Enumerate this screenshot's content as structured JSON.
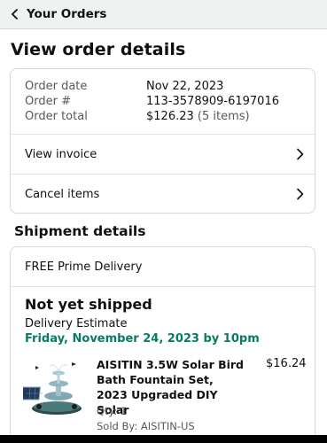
{
  "nav": {
    "back_label": "Your Orders"
  },
  "page": {
    "title": "View order details"
  },
  "order_summary": {
    "rows": [
      {
        "label": "Order date",
        "value": "Nov 22, 2023"
      },
      {
        "label": "Order #",
        "value": "113-3578909-6197016"
      },
      {
        "label": "Order total",
        "value": "$126.23",
        "note": "(5 items)"
      }
    ],
    "actions": [
      {
        "label": "View invoice"
      },
      {
        "label": "Cancel items"
      }
    ]
  },
  "shipment": {
    "section_title": "Shipment details",
    "delivery_type": "FREE Prime Delivery",
    "status": "Not yet shipped",
    "estimate_label": "Delivery Estimate",
    "estimate_date": "Friday, November 24, 2023 by 10pm",
    "colors": {
      "estimate_green": "#067d62"
    },
    "items": [
      {
        "title": "AISITIN 3.5W Solar Bird Bath Fountain Set, 2023 Upgraded DIY Solar",
        "price": "$16.24",
        "qty": "Qty: 1",
        "seller": "Sold By: AISITIN-US",
        "image_icon": "solar-fountain-product-image"
      }
    ]
  },
  "icons": {
    "back": "chevron-left-icon",
    "row_arrow": "chevron-right-icon"
  }
}
